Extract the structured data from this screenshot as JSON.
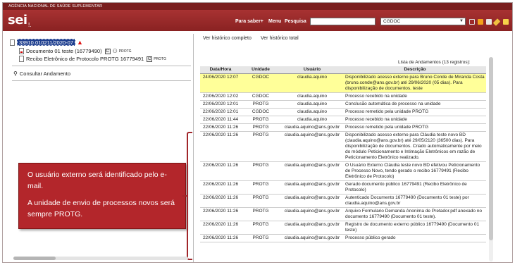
{
  "agency": "AGÊNCIA NACIONAL DE SAÚDE SUPLEMENTAR",
  "header": {
    "logo": "sei",
    "logo_suffix": "!.",
    "nav": [
      "Para saber+",
      "Menu",
      "Pesquisa"
    ],
    "search_value": "",
    "unit_selected": "CGDOC",
    "accent": "#9b2a2a"
  },
  "tree": {
    "process_number": "33910.010211/2020-07",
    "doc1_label": "Documento 01 teste (16779490)",
    "doc1_badge": "C",
    "doc1_unit": "PROTG",
    "doc2_label": "Recibo Eletrônico de Protocolo PROTG 16779491",
    "doc2_badge": "C",
    "doc2_unit": "PROTG",
    "consult_label": "Consultar Andamento"
  },
  "callout": {
    "line1": "O usuário externo será identificado pelo e-mail.",
    "line2": "A unidade de envio de processos novos será sempre PROTG.",
    "color": "#b3262b"
  },
  "right": {
    "link_full": "Ver histórico completo",
    "link_total": "Ver histórico total",
    "caption": "Lista de Andamentos (13 registros):"
  },
  "table": {
    "headers": [
      "Data/Hora",
      "Unidade",
      "Usuário",
      "Descrição"
    ],
    "rows": [
      {
        "date": "24/06/2020 12:07",
        "unit": "CGDOC",
        "user": "claudia.aquino",
        "desc": "Disponibilizado acesso externo para Bruno Conde de Miranda Costa (bruno.conde@ans.gov.br) até 29/06/2020 (05 dias). Para disponibilização de documentos. teste",
        "highlight": true
      },
      {
        "date": "22/06/2020 12:02",
        "unit": "CGDOC",
        "user": "claudia.aquino",
        "desc": "Processo recebido na unidade"
      },
      {
        "date": "22/06/2020 12:01",
        "unit": "PROTG",
        "user": "claudia.aquino",
        "desc": "Conclusão automática de processo na unidade"
      },
      {
        "date": "22/06/2020 12:01",
        "unit": "CGDOC",
        "user": "claudia.aquino",
        "desc": "Processo remetido pela unidade PROTG"
      },
      {
        "date": "22/06/2020 11:44",
        "unit": "PROTG",
        "user": "claudia.aquino",
        "desc": "Processo recebido na unidade"
      },
      {
        "date": "22/06/2020 11:26",
        "unit": "PROTG",
        "user": "claudia.aquino@ans.gov.br",
        "desc": "Processo remetido pela unidade PROTG"
      },
      {
        "date": "22/06/2020 11:26",
        "unit": "PROTG",
        "user": "claudia.aquino@ans.gov.br",
        "desc": "Disponibilizado acesso externo para Cláudia teste novo BD (claudia.aquino@ans.gov.br) até 29/05/2120 (36500 dias). Para disponibilização de documentos. Criado automaticamente por meio do módulo Peticionamento e Intimação Eletrônicos em razão de Peticionamento Eletrônico realizado."
      },
      {
        "date": "22/06/2020 11:26",
        "unit": "PROTG",
        "user": "claudia.aquino@ans.gov.br",
        "desc": "O Usuário Externo Cláudia teste novo BD efetivou Peticionamento de Processo Novo, tendo gerado o recibo 16779491 (Recibo Eletrônico de Protocolo)"
      },
      {
        "date": "22/06/2020 11:26",
        "unit": "PROTG",
        "user": "claudia.aquino@ans.gov.br",
        "desc": "Gerado documento público 16779491 (Recibo Eletrônico de Protocolo)"
      },
      {
        "date": "22/06/2020 11:26",
        "unit": "PROTG",
        "user": "claudia.aquino@ans.gov.br",
        "desc": "Autenticado Documento 16779490 (Documento 01 teste) por claudia.aquino@ans.gov.br"
      },
      {
        "date": "22/06/2020 11:26",
        "unit": "PROTG",
        "user": "claudia.aquino@ans.gov.br",
        "desc": "Arquivo Formulario Demanda Anonima de Pretador.pdf anexado no documento 16779490 (Documento 01 teste)."
      },
      {
        "date": "22/06/2020 11:26",
        "unit": "PROTG",
        "user": "claudia.aquino@ans.gov.br",
        "desc": "Registro de documento externo público 16779490 (Documento 01 teste)"
      },
      {
        "date": "22/06/2020 11:26",
        "unit": "PROTG",
        "user": "claudia.aquino@ans.gov.br",
        "desc": "Processo público gerado"
      }
    ]
  }
}
